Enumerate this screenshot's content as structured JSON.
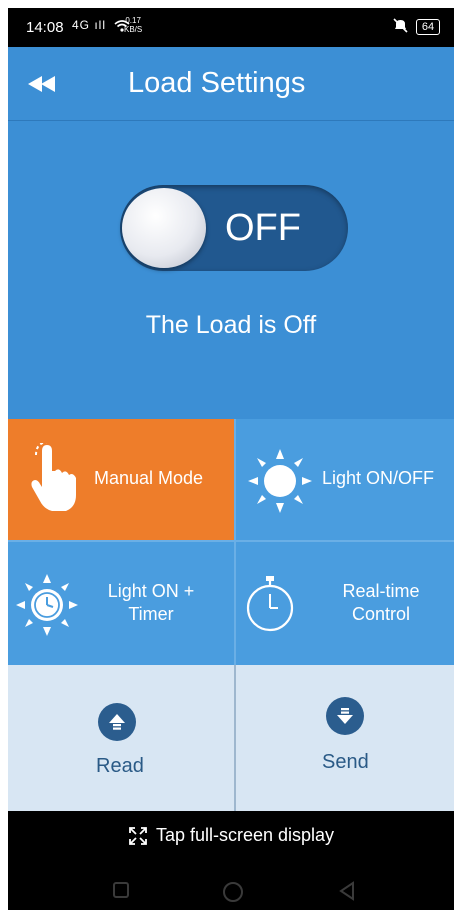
{
  "status_bar": {
    "time": "14:08",
    "signal": "4G ıll",
    "speed_value": "0.17",
    "speed_unit": "KB/S",
    "battery": "64"
  },
  "header": {
    "title": "Load Settings",
    "back_icon": "double-left-arrow-icon"
  },
  "toggle": {
    "state_label": "OFF",
    "is_on": false
  },
  "load_status": "The Load is Off",
  "modes": [
    {
      "label": "Manual Mode",
      "icon": "hand-tap-icon",
      "active": true
    },
    {
      "label": "Light ON/OFF",
      "icon": "sun-icon",
      "active": false
    },
    {
      "label": "Light ON +\nTimer",
      "icon": "sun-clock-icon",
      "active": false
    },
    {
      "label": "Real-time\nControl",
      "icon": "stopwatch-icon",
      "active": false
    }
  ],
  "actions": {
    "read_label": "Read",
    "send_label": "Send"
  },
  "bottom": {
    "fullscreen_label": "Tap full-screen display"
  },
  "colors": {
    "header_blue": "#3c8fd5",
    "grid_blue": "#4a9ddf",
    "active_orange": "#ee7d2a",
    "toggle_track": "#21588f",
    "action_bg": "#d8e6f3",
    "action_icon": "#2b5d8e"
  }
}
